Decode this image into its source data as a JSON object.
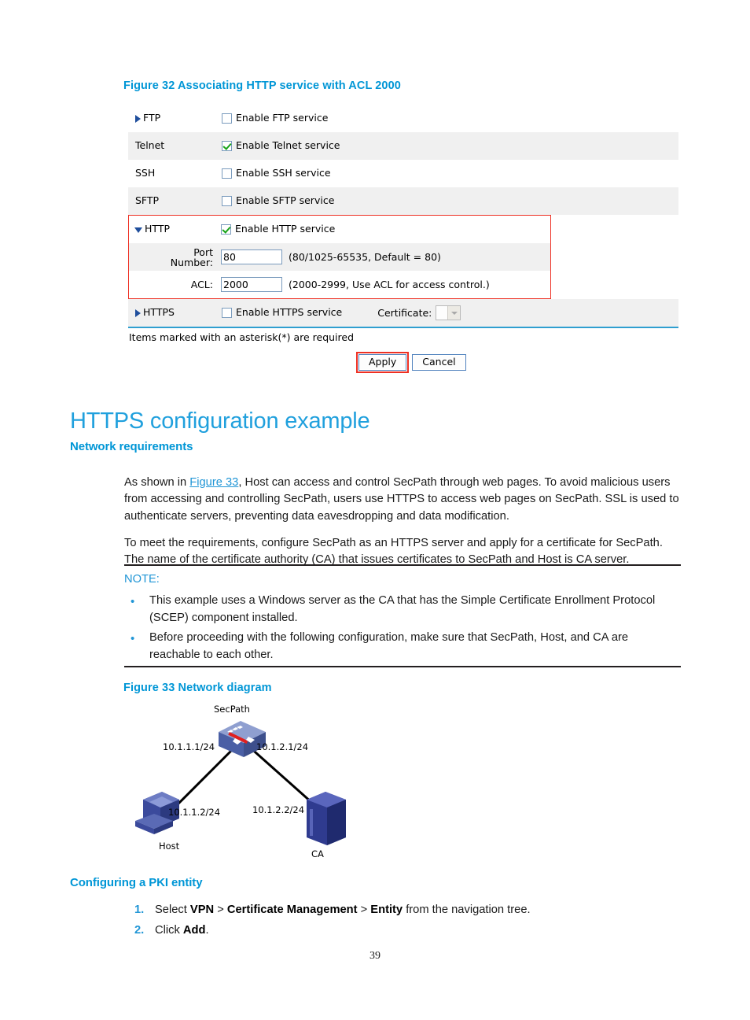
{
  "figure32": {
    "caption": "Figure 32 Associating HTTP service with ACL 2000",
    "rows": [
      {
        "label": "FTP",
        "toggle": "collapsed",
        "checkbox_label": "Enable FTP service",
        "checked": false
      },
      {
        "label": "Telnet",
        "toggle": "none",
        "checkbox_label": "Enable Telnet service",
        "checked": true
      },
      {
        "label": "SSH",
        "toggle": "none",
        "checkbox_label": "Enable SSH service",
        "checked": false
      },
      {
        "label": "SFTP",
        "toggle": "none",
        "checkbox_label": "Enable SFTP service",
        "checked": false
      }
    ],
    "http": {
      "label": "HTTP",
      "toggle": "expanded",
      "checkbox_label": "Enable HTTP service",
      "checked": true,
      "port_label": "Port Number:",
      "port_value": "80",
      "port_hint": "(80/1025-65535, Default = 80)",
      "acl_label": "ACL:",
      "acl_value": "2000",
      "acl_hint": "(2000-2999, Use ACL for access control.)"
    },
    "https": {
      "label": "HTTPS",
      "toggle": "collapsed",
      "checkbox_label": "Enable HTTPS service",
      "checked": false,
      "certificate_label": "Certificate:",
      "certificate_value": ""
    },
    "required_note": "Items marked with an asterisk(*) are required",
    "apply_label": "Apply",
    "cancel_label": "Cancel",
    "highlight_color": "#ee3124",
    "accent_rule_color": "#2f9fd0"
  },
  "heading": {
    "h1": "HTTPS configuration example",
    "network_requirements": "Network requirements",
    "configuring_pki": "Configuring a PKI entity"
  },
  "paragraphs": {
    "p1_part1": "As shown in ",
    "p1_xref": "Figure 33",
    "p1_part2": ", Host can access and control SecPath through web pages. To avoid malicious users from accessing and controlling SecPath, users use HTTPS to access web pages on SecPath. SSL is used to authenticate servers, preventing data eavesdropping and data modification.",
    "p2": "To meet the requirements, configure SecPath as an HTTPS server and apply for a certificate for SecPath. The name of the certificate authority (CA) that issues certificates to SecPath and Host is CA server."
  },
  "note": {
    "label": "NOTE:",
    "items": [
      "This example uses a Windows server as the CA that has the Simple Certificate Enrollment Protocol (SCEP) component installed.",
      "Before proceeding with the following configuration, make sure that SecPath, Host, and CA are reachable to each other."
    ]
  },
  "figure33": {
    "caption": "Figure 33 Network diagram",
    "nodes": [
      {
        "name": "SecPath",
        "label": "SecPath"
      },
      {
        "name": "Host",
        "label": "Host"
      },
      {
        "name": "CA",
        "label": "CA"
      }
    ],
    "interface_labels": {
      "secpath_left": "10.1.1.1/24",
      "secpath_right": "10.1.2.1/24",
      "host": "10.1.1.2/24",
      "ca": "10.1.2.2/24"
    }
  },
  "steps": [
    {
      "number": "1.",
      "prefix": "Select ",
      "bold1": "VPN",
      "sep1": " > ",
      "bold2": "Certificate Management",
      "sep2": " > ",
      "bold3": "Entity",
      "suffix": " from the navigation tree."
    },
    {
      "number": "2.",
      "prefix": "Click ",
      "bold1": "Add",
      "suffix": "."
    }
  ],
  "page_number": "39"
}
